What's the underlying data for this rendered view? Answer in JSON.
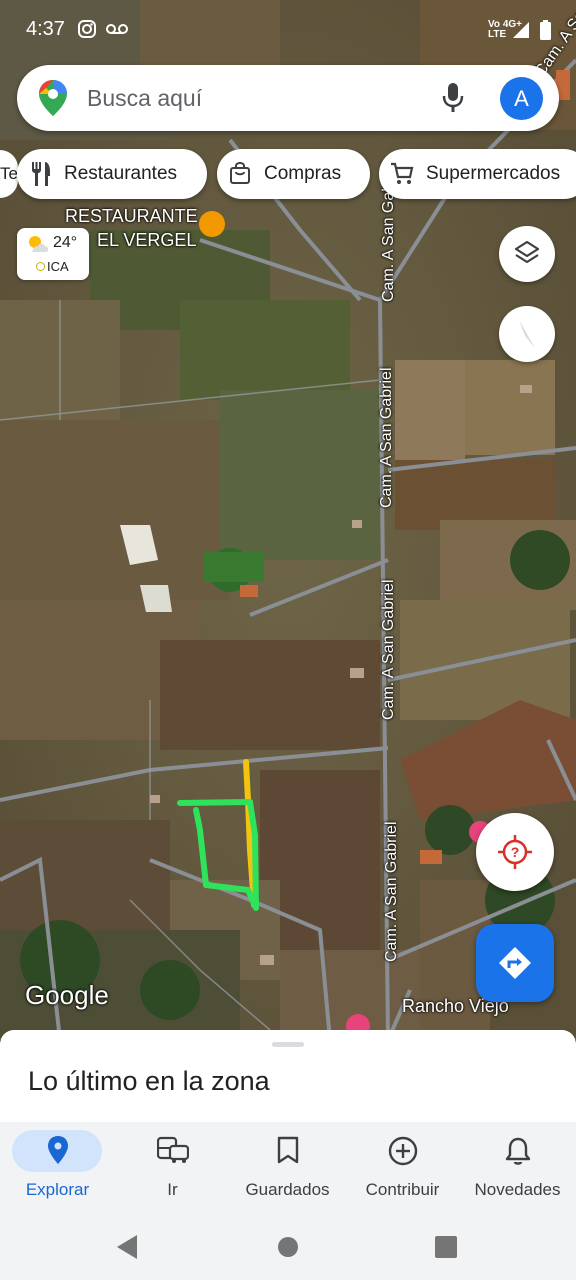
{
  "status_bar": {
    "time": "4:37",
    "network_top": "Vo 4G+",
    "network_bottom": "LTE"
  },
  "search": {
    "placeholder": "Busca aquí",
    "avatar_letter": "A"
  },
  "chips": [
    {
      "label": "Restaurantes",
      "icon": "fork-knife-icon"
    },
    {
      "label": "Compras",
      "icon": "shopping-bag-icon"
    },
    {
      "label": "Supermercados",
      "icon": "shopping-cart-icon"
    }
  ],
  "chip_edge_label": "Te",
  "weather": {
    "temperature": "24°",
    "air_quality": "ICA"
  },
  "map": {
    "poi": {
      "line1": "RESTAURANTE",
      "line2": "EL VERGEL"
    },
    "road_labels": [
      "Cam. A San Gabriel",
      "Cam. A San Gabriel",
      "Cam. A San Gabriel",
      "Cam. A San Gabriel",
      "Cam. A San Gab"
    ],
    "place_label": "Rancho Viejo",
    "attribution": "Google"
  },
  "sheet": {
    "title": "Lo último en la zona"
  },
  "bottom_nav": [
    {
      "label": "Explorar",
      "icon": "location-pin-icon",
      "active": true
    },
    {
      "label": "Ir",
      "icon": "commute-icon",
      "active": false
    },
    {
      "label": "Guardados",
      "icon": "bookmark-icon",
      "active": false
    },
    {
      "label": "Contribuir",
      "icon": "add-circle-icon",
      "active": false
    },
    {
      "label": "Novedades",
      "icon": "bell-icon",
      "active": false
    }
  ],
  "colors": {
    "brand_blue": "#1a73e8",
    "active_nav": "#1967d2",
    "drawn_line_yellow": "#f2c40f",
    "drawn_line_green": "#2ee35a",
    "compass_red": "#d93025"
  }
}
